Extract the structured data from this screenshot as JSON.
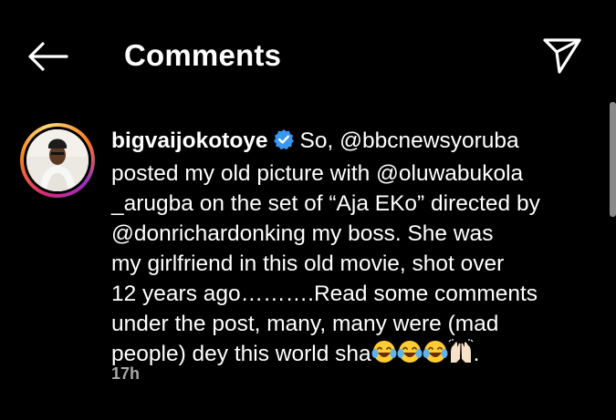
{
  "header": {
    "title": "Comments",
    "back_icon": "arrow-left-icon",
    "send_icon": "paper-plane-icon"
  },
  "comment": {
    "username": "bigvaijokotoye",
    "verified": true,
    "text_line1": "So, @bbcnewsyoruba",
    "text_line2": "posted my old picture with @oluwabukola",
    "text_line3": "_arugba on the set of “Aja EKo” directed by",
    "text_line4": "@donrichardonking  my boss. She was",
    "text_line5": "my girlfriend in this old movie, shot over",
    "text_line6": "12 years ago……….Read some comments",
    "text_line7": "under the post, many, many were (mad",
    "text_line8": "people) dey this world sha",
    "text_end": ".",
    "emojis": [
      "face-with-tears-of-joy",
      "face-with-tears-of-joy",
      "face-with-tears-of-joy",
      "raising-hands"
    ],
    "timestamp": "17h"
  },
  "colors": {
    "background": "#000000",
    "text": "#ffffff",
    "muted": "#a8a8a8",
    "verified_blue": "#3897f0"
  }
}
